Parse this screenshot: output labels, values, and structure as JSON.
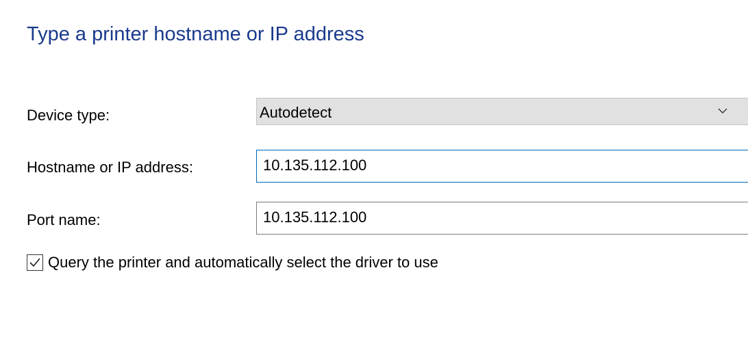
{
  "page": {
    "title": "Type a printer hostname or IP address"
  },
  "form": {
    "device_type": {
      "label": "Device type:",
      "selected": "Autodetect"
    },
    "hostname": {
      "label": "Hostname or IP address:",
      "value": "10.135.112.100"
    },
    "port_name": {
      "label": "Port name:",
      "value": "10.135.112.100"
    },
    "query_printer": {
      "label": "Query the printer and automatically select the driver to use",
      "checked": true
    }
  },
  "icons": {
    "dropdown": "chevron-down-icon",
    "checkbox_mark": "checkmark-icon"
  },
  "colors": {
    "title": "#1a3a8c",
    "focus_border": "#0067b8",
    "select_background": "#e1e1e1"
  }
}
